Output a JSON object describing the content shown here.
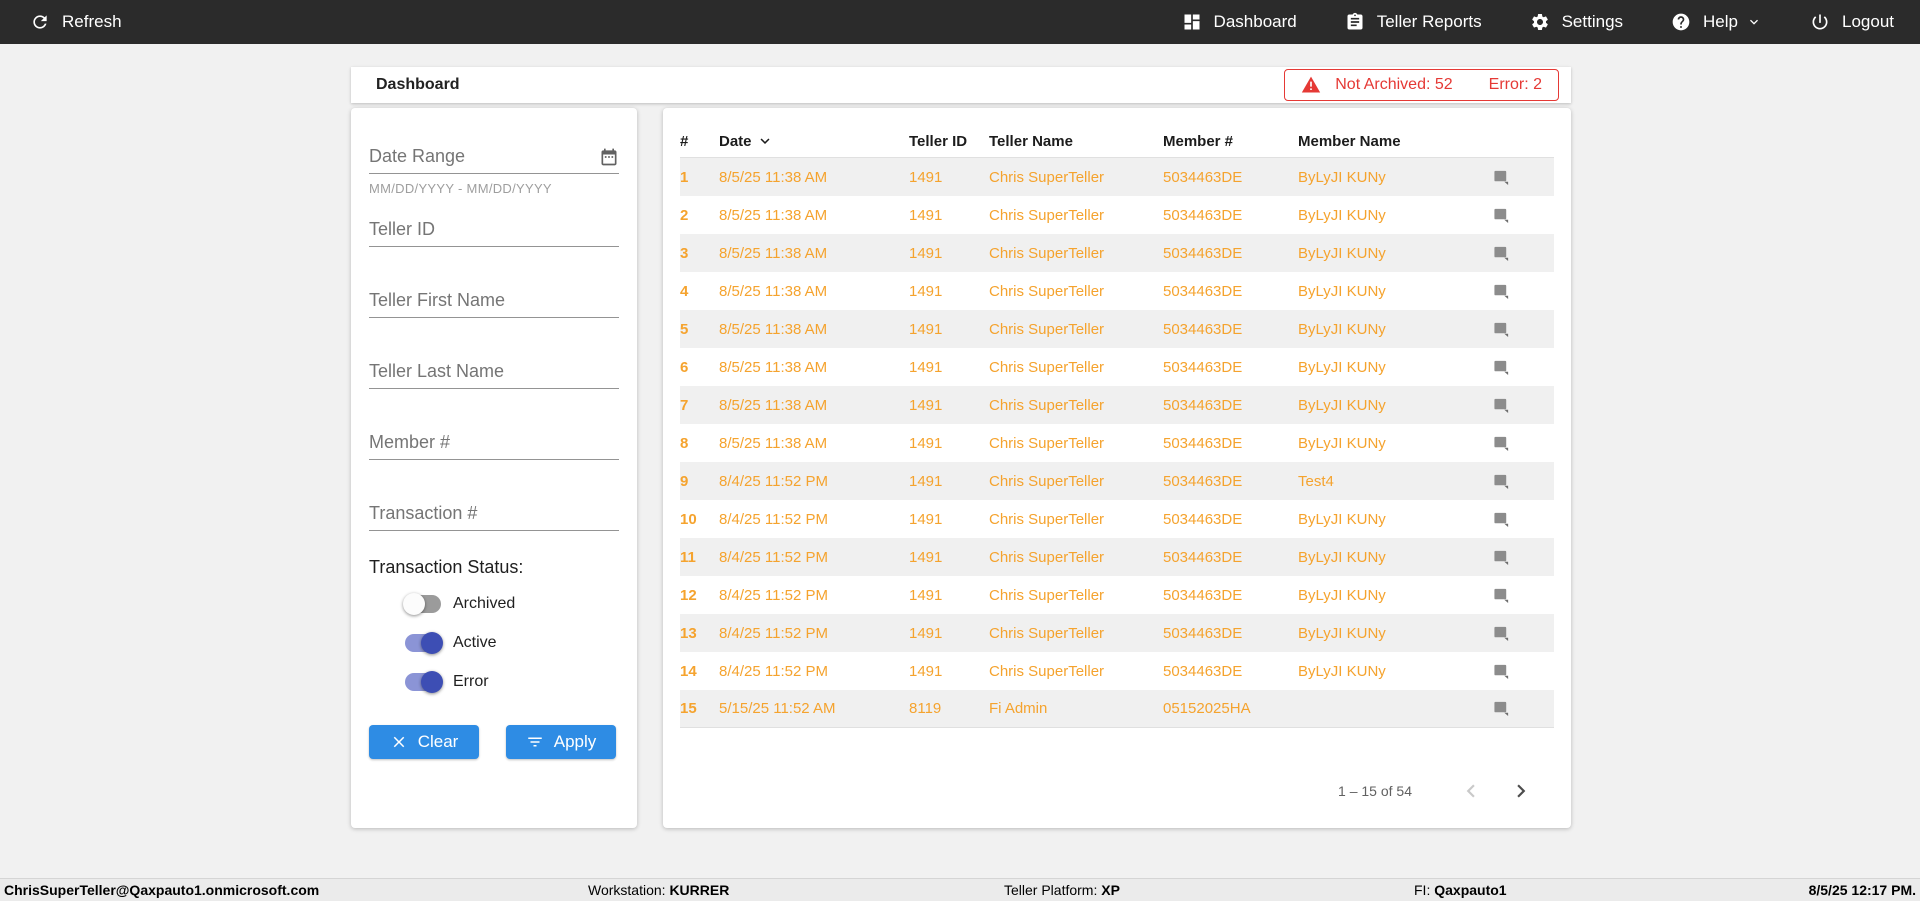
{
  "colors": {
    "nav_background": "#2b2b2b",
    "row_text_orange": "#F5A32E",
    "error_red": "#E53935",
    "button_blue": "#2E8CE4",
    "toggle_on_indigo": "#3D4EB4"
  },
  "top_nav": {
    "refresh_label": "Refresh",
    "refresh_icon": "refresh-icon",
    "items": [
      {
        "label": "Dashboard",
        "icon": "dashboard-icon"
      },
      {
        "label": "Teller Reports",
        "icon": "clipboard-icon"
      },
      {
        "label": "Settings",
        "icon": "gear-icon"
      },
      {
        "label": "Help",
        "icon": "help-icon",
        "has_dropdown": true
      },
      {
        "label": "Logout",
        "icon": "power-icon"
      }
    ]
  },
  "header": {
    "title": "Dashboard",
    "alert": {
      "icon": "warning-triangle-icon",
      "not_archived": "Not Archived: 52",
      "error": "Error: 2"
    }
  },
  "filters": {
    "date_range_label": "Date Range",
    "date_range_icon": "calendar-icon",
    "date_range_hint": "MM/DD/YYYY - MM/DD/YYYY",
    "teller_id_label": "Teller ID",
    "teller_first_name_label": "Teller First Name",
    "teller_last_name_label": "Teller Last Name",
    "member_number_label": "Member #",
    "transaction_number_label": "Transaction #",
    "transaction_status_label": "Transaction Status:",
    "toggles": [
      {
        "label": "Archived",
        "on": false
      },
      {
        "label": "Active",
        "on": true
      },
      {
        "label": "Error",
        "on": true
      }
    ],
    "clear_label": "Clear",
    "clear_icon": "close-x-icon",
    "apply_label": "Apply",
    "apply_icon": "filter-icon"
  },
  "table": {
    "columns": [
      "#",
      "Date",
      "Teller ID",
      "Teller Name",
      "Member #",
      "Member Name"
    ],
    "sort": {
      "column": "Date",
      "direction": "desc",
      "icon": "chevron-down-icon"
    },
    "row_action_icon": "note-icon",
    "rows": [
      {
        "n": "1",
        "date": "8/5/25 11:38 AM",
        "teller_id": "1491",
        "teller_name": "Chris SuperTeller",
        "member_number": "5034463DE",
        "member_name": "ByLyJI KUNy"
      },
      {
        "n": "2",
        "date": "8/5/25 11:38 AM",
        "teller_id": "1491",
        "teller_name": "Chris SuperTeller",
        "member_number": "5034463DE",
        "member_name": "ByLyJI KUNy"
      },
      {
        "n": "3",
        "date": "8/5/25 11:38 AM",
        "teller_id": "1491",
        "teller_name": "Chris SuperTeller",
        "member_number": "5034463DE",
        "member_name": "ByLyJI KUNy"
      },
      {
        "n": "4",
        "date": "8/5/25 11:38 AM",
        "teller_id": "1491",
        "teller_name": "Chris SuperTeller",
        "member_number": "5034463DE",
        "member_name": "ByLyJI KUNy"
      },
      {
        "n": "5",
        "date": "8/5/25 11:38 AM",
        "teller_id": "1491",
        "teller_name": "Chris SuperTeller",
        "member_number": "5034463DE",
        "member_name": "ByLyJI KUNy"
      },
      {
        "n": "6",
        "date": "8/5/25 11:38 AM",
        "teller_id": "1491",
        "teller_name": "Chris SuperTeller",
        "member_number": "5034463DE",
        "member_name": "ByLyJI KUNy"
      },
      {
        "n": "7",
        "date": "8/5/25 11:38 AM",
        "teller_id": "1491",
        "teller_name": "Chris SuperTeller",
        "member_number": "5034463DE",
        "member_name": "ByLyJI KUNy"
      },
      {
        "n": "8",
        "date": "8/5/25 11:38 AM",
        "teller_id": "1491",
        "teller_name": "Chris SuperTeller",
        "member_number": "5034463DE",
        "member_name": "ByLyJI KUNy"
      },
      {
        "n": "9",
        "date": "8/4/25 11:52 PM",
        "teller_id": "1491",
        "teller_name": "Chris SuperTeller",
        "member_number": "5034463DE",
        "member_name": "Test4"
      },
      {
        "n": "10",
        "date": "8/4/25 11:52 PM",
        "teller_id": "1491",
        "teller_name": "Chris SuperTeller",
        "member_number": "5034463DE",
        "member_name": "ByLyJI KUNy"
      },
      {
        "n": "11",
        "date": "8/4/25 11:52 PM",
        "teller_id": "1491",
        "teller_name": "Chris SuperTeller",
        "member_number": "5034463DE",
        "member_name": "ByLyJI KUNy"
      },
      {
        "n": "12",
        "date": "8/4/25 11:52 PM",
        "teller_id": "1491",
        "teller_name": "Chris SuperTeller",
        "member_number": "5034463DE",
        "member_name": "ByLyJI KUNy"
      },
      {
        "n": "13",
        "date": "8/4/25 11:52 PM",
        "teller_id": "1491",
        "teller_name": "Chris SuperTeller",
        "member_number": "5034463DE",
        "member_name": "ByLyJI KUNy"
      },
      {
        "n": "14",
        "date": "8/4/25 11:52 PM",
        "teller_id": "1491",
        "teller_name": "Chris SuperTeller",
        "member_number": "5034463DE",
        "member_name": "ByLyJI KUNy"
      },
      {
        "n": "15",
        "date": "5/15/25 11:52 AM",
        "teller_id": "8119",
        "teller_name": "Fi Admin",
        "member_number": "05152025HA",
        "member_name": ""
      }
    ],
    "pagination": {
      "range_text": "1 – 15 of 54",
      "prev_icon": "chevron-left-icon",
      "next_icon": "chevron-right-icon",
      "prev_enabled": false,
      "next_enabled": true
    }
  },
  "status_bar": {
    "user": "ChrisSuperTeller@Qaxpauto1.onmicrosoft.com",
    "workstation_label": "Workstation:",
    "workstation": "KURRER",
    "platform_label": "Teller Platform:",
    "platform": "XP",
    "fi_label": "FI:",
    "fi": "Qaxpauto1",
    "timestamp": "8/5/25 12:17 PM."
  }
}
